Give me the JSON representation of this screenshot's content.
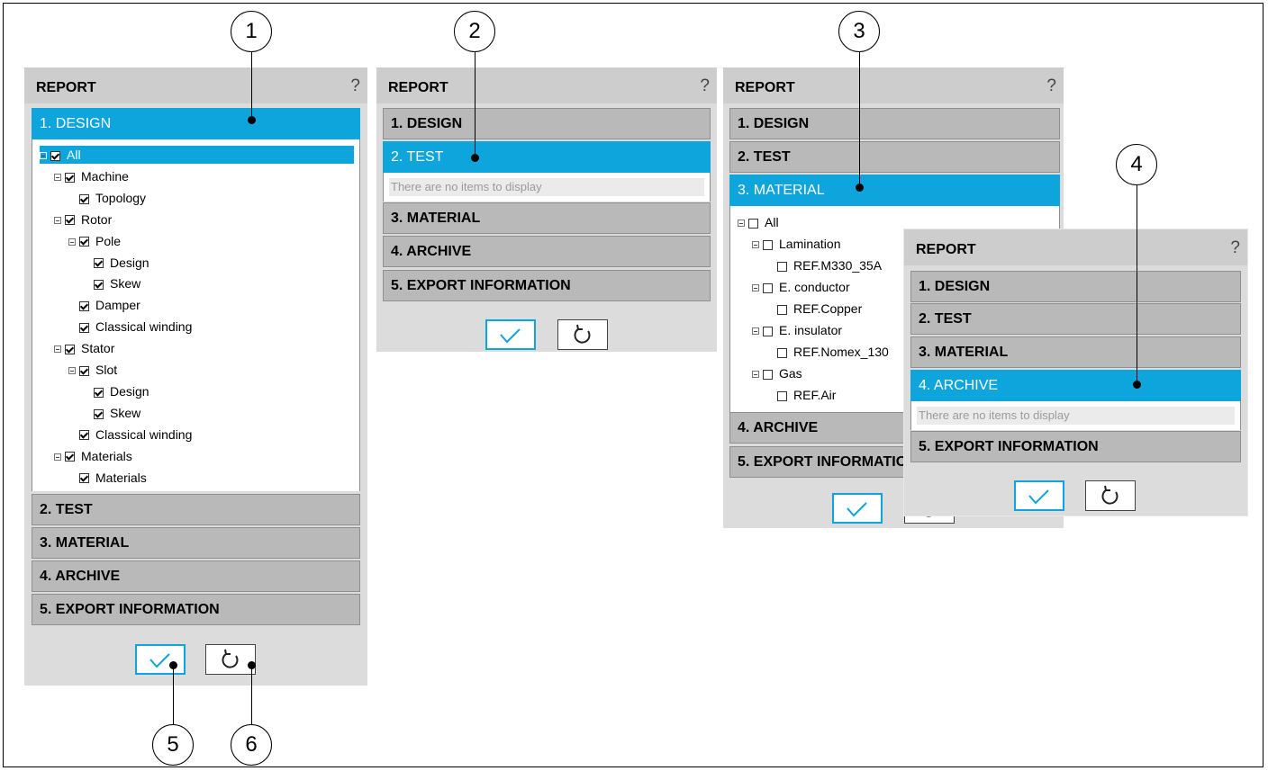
{
  "panel_title": "REPORT",
  "help_icon": "?",
  "empty_message": "There are no items to display",
  "sections": {
    "design": "1. DESIGN",
    "test": "2. TEST",
    "material": "3. MATERIAL",
    "archive": "4. ARCHIVE",
    "export": "5. EXPORT INFORMATION"
  },
  "design_tree": [
    {
      "label": "All",
      "level": 0,
      "expander": true,
      "checked": true,
      "selected": true
    },
    {
      "label": "Machine",
      "level": 1,
      "expander": true,
      "checked": true
    },
    {
      "label": "Topology",
      "level": 2,
      "expander": false,
      "checked": true
    },
    {
      "label": "Rotor",
      "level": 1,
      "expander": true,
      "checked": true
    },
    {
      "label": "Pole",
      "level": 2,
      "expander": true,
      "checked": true
    },
    {
      "label": "Design",
      "level": 3,
      "expander": false,
      "checked": true
    },
    {
      "label": "Skew",
      "level": 3,
      "expander": false,
      "checked": true
    },
    {
      "label": "Damper",
      "level": 2,
      "expander": false,
      "checked": true
    },
    {
      "label": "Classical winding",
      "level": 2,
      "expander": false,
      "checked": true
    },
    {
      "label": "Stator",
      "level": 1,
      "expander": true,
      "checked": true
    },
    {
      "label": "Slot",
      "level": 2,
      "expander": true,
      "checked": true
    },
    {
      "label": "Design",
      "level": 3,
      "expander": false,
      "checked": true
    },
    {
      "label": "Skew",
      "level": 3,
      "expander": false,
      "checked": true
    },
    {
      "label": "Classical winding",
      "level": 2,
      "expander": false,
      "checked": true
    },
    {
      "label": "Materials",
      "level": 1,
      "expander": true,
      "checked": true
    },
    {
      "label": "Materials",
      "level": 2,
      "expander": false,
      "checked": true
    }
  ],
  "material_tree": [
    {
      "label": "All",
      "level": 0,
      "expander": true,
      "checked": false
    },
    {
      "label": "Lamination",
      "level": 1,
      "expander": true,
      "checked": false
    },
    {
      "label": "REF.M330_35A",
      "level": 2,
      "expander": false,
      "checked": false
    },
    {
      "label": "E. conductor",
      "level": 1,
      "expander": true,
      "checked": false
    },
    {
      "label": "REF.Copper",
      "level": 2,
      "expander": false,
      "checked": false
    },
    {
      "label": "E. insulator",
      "level": 1,
      "expander": true,
      "checked": false
    },
    {
      "label": "REF.Nomex_130",
      "level": 2,
      "expander": false,
      "checked": false
    },
    {
      "label": "Gas",
      "level": 1,
      "expander": true,
      "checked": false
    },
    {
      "label": "REF.Air",
      "level": 2,
      "expander": false,
      "checked": false
    }
  ],
  "callouts": [
    "1",
    "2",
    "3",
    "4",
    "5",
    "6"
  ],
  "icons": {
    "ok": "check-icon",
    "reset": "reset-icon"
  },
  "colors": {
    "accent": "#0ea4dc",
    "section": "#b9b9b9",
    "panel": "#dcdcdc"
  }
}
